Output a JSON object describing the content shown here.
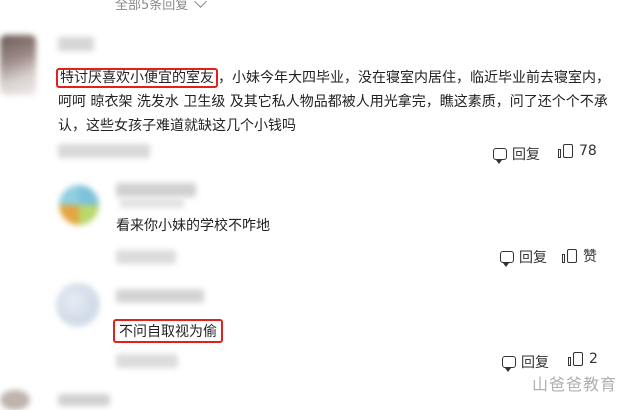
{
  "top": {
    "expand_label": "全部5条回复"
  },
  "comment": {
    "highlight": "特讨厌喜欢小便宜的室友",
    "text": "，小妹今年大四毕业，没在寝室内居住，临近毕业前去寝室内，呵呵 晾衣架 洗发水 卫生级 及其它私人物品都被人用光拿完，瞧这素质，问了还个个不承认，这些女孩子难道就缺这几个小钱吗",
    "reply_label": "回复",
    "like_count": "78"
  },
  "replies": [
    {
      "text": "看来你小妹的学校不咋地",
      "reply_label": "回复",
      "like_label": "赞"
    },
    {
      "text": "不问自取视为偷",
      "reply_label": "回复",
      "like_count": "2"
    }
  ],
  "watermark": "山爸爸教育"
}
